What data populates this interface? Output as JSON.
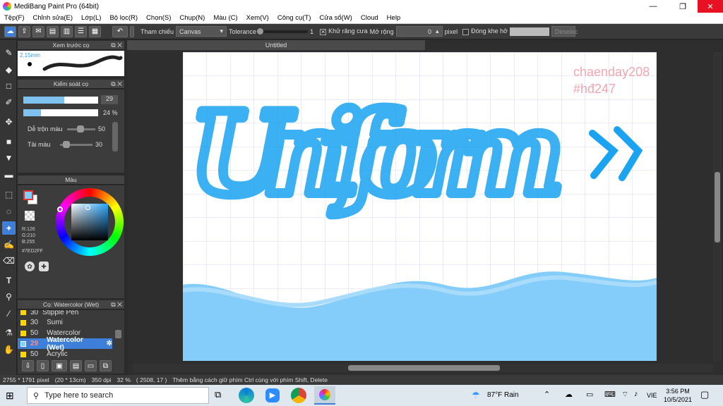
{
  "window": {
    "title": "MediBang Paint Pro (64bit)",
    "min": "—",
    "max": "❐",
    "close": "✕"
  },
  "menu": [
    "Tệp(F)",
    "Chỉnh sửa(E)",
    "Lớp(L)",
    "Bộ lọc(R)",
    "Chọn(S)",
    "Chụp(N)",
    "Màu (C)",
    "Xem(V)",
    "Công cụ(T)",
    "Cửa sổ(W)",
    "Cloud",
    "Help"
  ],
  "toolbar": {
    "reference_label": "Tham chiếu",
    "reference_value": "Canvas",
    "tolerance_label": "Tolerance",
    "tolerance_value": "1",
    "antialias_label": "Khử răng cưa",
    "expand_label": "Mở rộng",
    "expand_value": "0",
    "expand_unit": "pixel",
    "close_gap_label": "Đóng khe hở",
    "deselect_label": "Deselec"
  },
  "panels": {
    "brush_preview": {
      "title": "Xem trước cọ",
      "size": "2.15mm"
    },
    "brush_control": {
      "title": "Kiểm soát cọ",
      "size_value": "29",
      "opacity_value": "24 %",
      "blend_label": "Dễ trộn màu",
      "blend_value": "50",
      "reload_label": "Tải màu",
      "reload_value": "30"
    },
    "color": {
      "title": "Màu",
      "r": "R:126",
      "g": "G:210",
      "b": "B:255",
      "hex": "#7ED2FF"
    },
    "brush_list": {
      "title": "Cọ: Watercolor (Wet)",
      "items": [
        {
          "size": "30",
          "name": "Stipple Pen"
        },
        {
          "size": "30",
          "name": "Sumi"
        },
        {
          "size": "50",
          "name": "Watercolor"
        },
        {
          "size": "29",
          "name": "Watercolor (Wet)"
        },
        {
          "size": "50",
          "name": "Acrylic"
        }
      ]
    }
  },
  "document": {
    "tab_title": "Untitled",
    "watermark_line1": "chaenday208",
    "watermark_line2": "#hđ247",
    "artwork_text": "Uniform"
  },
  "status": {
    "dimensions": "2755 * 1791 pixel",
    "size_cm": "(20 * 13cm)",
    "dpi": "350 dpi",
    "zoom": "32 %",
    "cursor": "( 2508, 17 )",
    "hint": "Thêm bằng cách giữ phím Ctrl cùng với phím Shift, Delete"
  },
  "taskbar": {
    "search_placeholder": "Type here to search",
    "weather": "87°F Rain",
    "lang": "VIE",
    "time": "3:56 PM",
    "date": "10/5/2021"
  },
  "colors": {
    "accent": "#3d7fd9",
    "brush_blue": "#1aa3f0",
    "foreground": "#7ED2FF",
    "watermark": "#f4a6b0"
  }
}
